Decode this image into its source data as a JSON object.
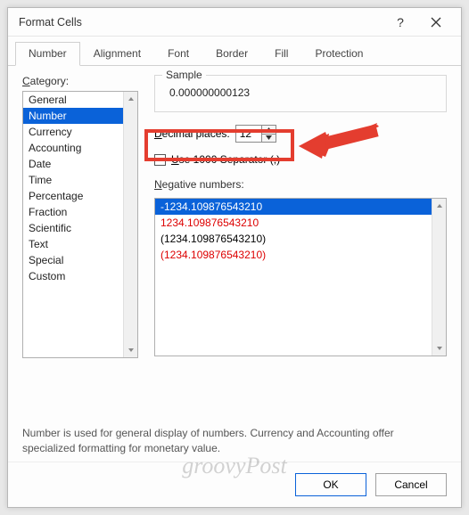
{
  "titlebar": {
    "title": "Format Cells"
  },
  "tabs": [
    "Number",
    "Alignment",
    "Font",
    "Border",
    "Fill",
    "Protection"
  ],
  "active_tab_index": 0,
  "category": {
    "label": "Category:",
    "items": [
      "General",
      "Number",
      "Currency",
      "Accounting",
      "Date",
      "Time",
      "Percentage",
      "Fraction",
      "Scientific",
      "Text",
      "Special",
      "Custom"
    ],
    "selected_index": 1
  },
  "sample": {
    "label": "Sample",
    "value": "0.000000000123"
  },
  "decimal": {
    "label": "Decimal places:",
    "value": "12"
  },
  "separator": {
    "label": "Use 1000 Separator (,)",
    "checked": false
  },
  "negative": {
    "label": "Negative numbers:",
    "items": [
      {
        "text": "-1234.109876543210",
        "style": "sel"
      },
      {
        "text": "1234.109876543210",
        "style": "red"
      },
      {
        "text": "(1234.109876543210)",
        "style": ""
      },
      {
        "text": "(1234.109876543210)",
        "style": "red"
      }
    ]
  },
  "description": "Number is used for general display of numbers.  Currency and Accounting offer specialized formatting for monetary value.",
  "buttons": {
    "ok": "OK",
    "cancel": "Cancel"
  },
  "watermark": "groovyPost"
}
